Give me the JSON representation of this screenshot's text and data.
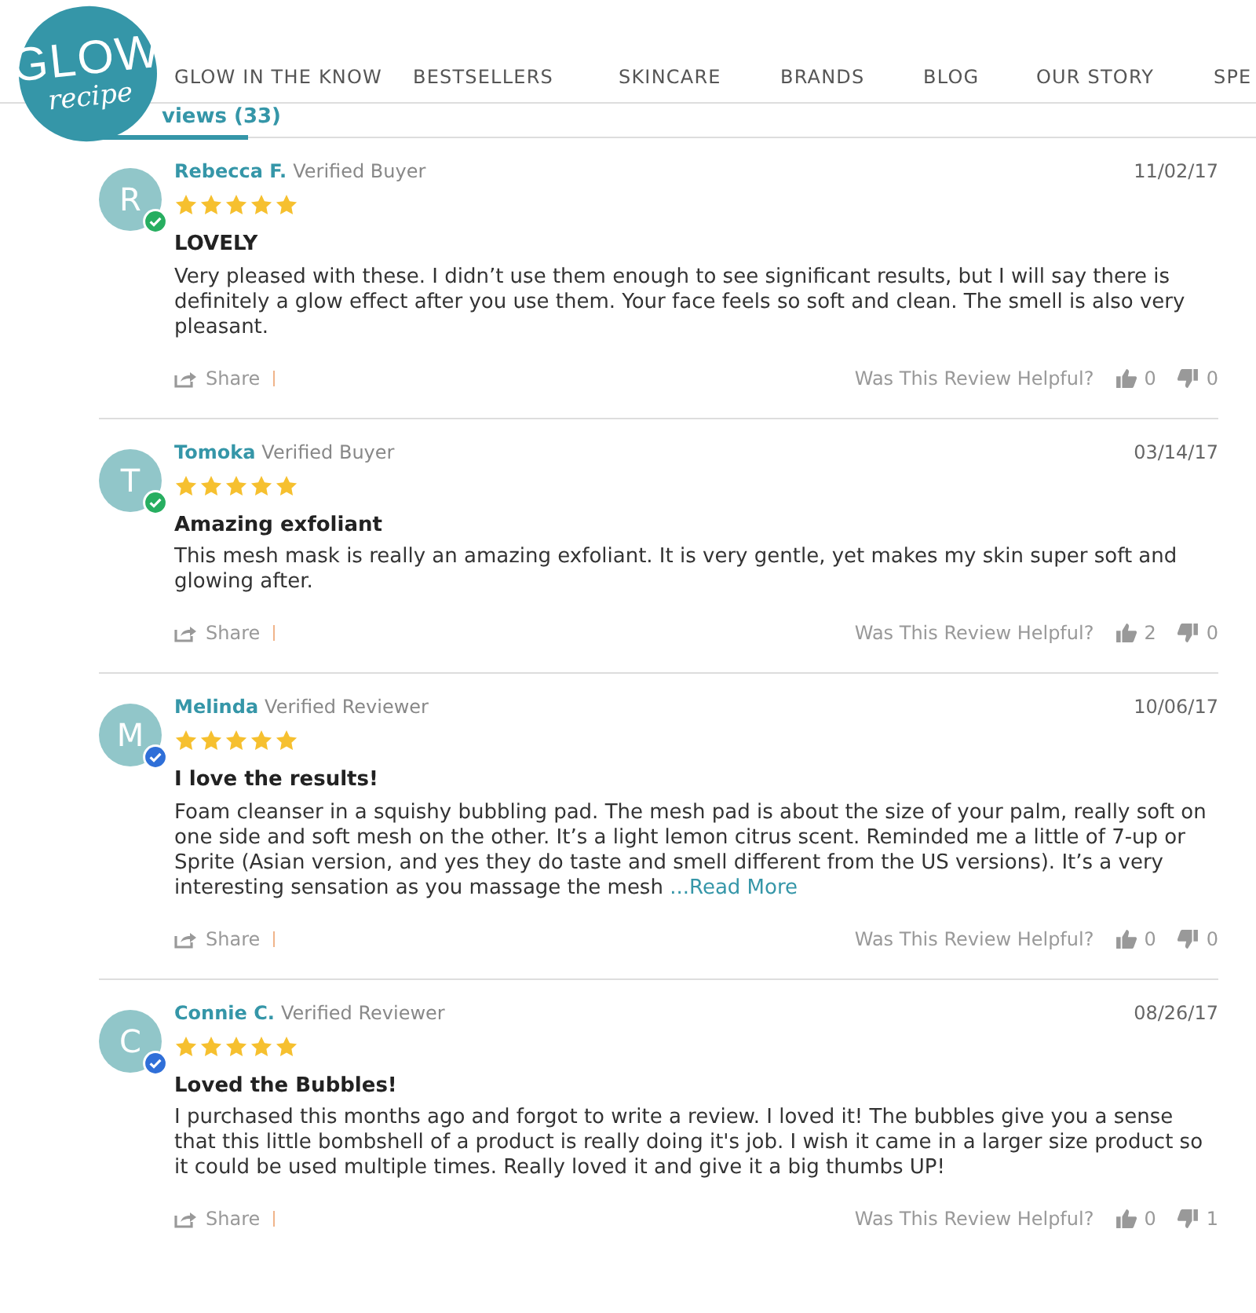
{
  "nav": {
    "items": [
      "GLOW IN THE KNOW",
      "BESTSELLERS",
      "SKINCARE",
      "BRANDS",
      "BLOG",
      "OUR STORY",
      "SPE"
    ]
  },
  "logo": {
    "line_1": "GLOW",
    "line_2": "recipe"
  },
  "tab": {
    "label": "views (33)",
    "selected": true
  },
  "reviews": [
    {
      "initial": "R",
      "name": "Rebecca F.",
      "status": "Verified Buyer",
      "color": "#27ae60",
      "date": "11/02/17",
      "stars": 5,
      "title": "LOVELY",
      "body": "Very pleased with these. I didn’t use them enough to see significant results, but I will say there is definitely a glow effect after you use them. Your face feels so soft and clean. The smell is also very pleasant.",
      "share": "Share",
      "helpful": "Was This Review Helpful?",
      "up": "0",
      "down": "0"
    },
    {
      "initial": "T",
      "name": "Tomoka",
      "status": "Verified Buyer",
      "color": "#27ae60",
      "date": "03/14/17",
      "stars": 5,
      "title": "Amazing exfoliant",
      "body": "This mesh mask is really an amazing exfoliant. It is very gentle, yet makes my skin super soft and glowing after.",
      "share": "Share",
      "helpful": "Was This Review Helpful?",
      "up": "2",
      "down": "0"
    },
    {
      "initial": "M",
      "name": "Melinda",
      "status": "Verified Reviewer",
      "color": "#2f6fd8",
      "date": "10/06/17",
      "stars": 5,
      "title": "I love the results!",
      "body": "Foam cleanser in a squishy bubbling pad. The mesh pad is about the size of your palm, really soft on one side and soft mesh on the other. It’s a light lemon citrus scent. Reminded me a little of 7-up or Sprite (Asian version, and yes they do taste and smell different from the US versions). It’s a very interesting sensation as you massage the mesh",
      "read_more": "...Read More",
      "share": "Share",
      "helpful": "Was This Review Helpful?",
      "up": "0",
      "down": "0"
    },
    {
      "initial": "C",
      "name": "Connie C.",
      "status": "Verified Reviewer",
      "color": "#2f6fd8",
      "date": "08/26/17",
      "stars": 5,
      "title": "Loved the Bubbles!",
      "body": "I purchased this months ago and forgot to write a review. I loved it! The bubbles give you a sense that this little bombshell of a product is really doing it's job. I wish it came in a larger size product so it could be used multiple times. Really loved it and give it a big thumbs UP!",
      "share": "Share",
      "helpful": "Was This Review Helpful?",
      "up": "0",
      "down": "1"
    }
  ]
}
